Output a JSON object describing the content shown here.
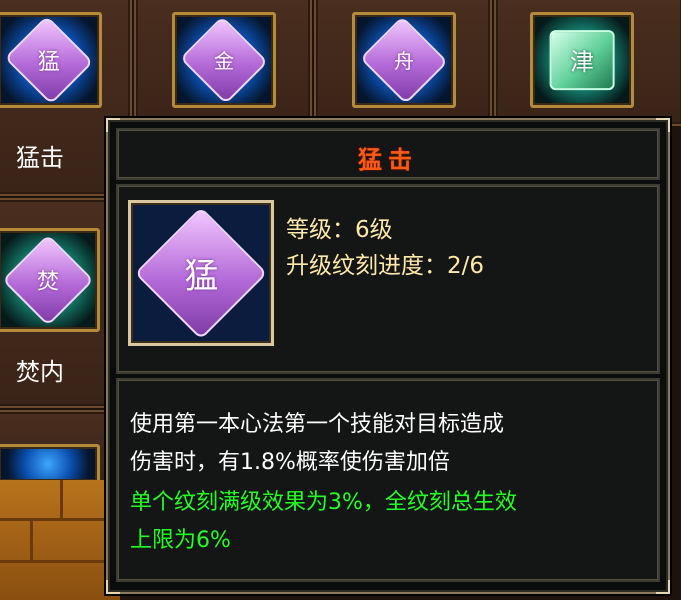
{
  "skills": [
    {
      "name": "猛击",
      "glyph": "猛",
      "gem": "purple"
    },
    {
      "name": "",
      "glyph": "金",
      "gem": "purple"
    },
    {
      "name": "",
      "glyph": "舟",
      "gem": "purple"
    },
    {
      "name": "",
      "glyph": "津",
      "gem": "green"
    },
    {
      "name": "焚内",
      "glyph": "焚",
      "gem": "purple"
    },
    {
      "name": "",
      "glyph": "",
      "gem": "purple"
    }
  ],
  "tooltip": {
    "title": "猛击",
    "icon_glyph": "猛",
    "level_text": "等级：6级",
    "progress_text": "升级纹刻进度：2/6",
    "description": [
      "使用第一本心法第一个技能对目标造成",
      "伤害时，有1.8%概率使伤害加倍"
    ],
    "bonus": [
      "单个纹刻满级效果为3%，全纹刻总生效",
      "上限为6%"
    ]
  },
  "colors": {
    "title": "#ff5a12",
    "stat_text": "#ffe9a8",
    "description": "#ffffff",
    "bonus": "#22ff22",
    "gem_purple": "#b46ad8",
    "gem_green": "#5fcf98"
  }
}
